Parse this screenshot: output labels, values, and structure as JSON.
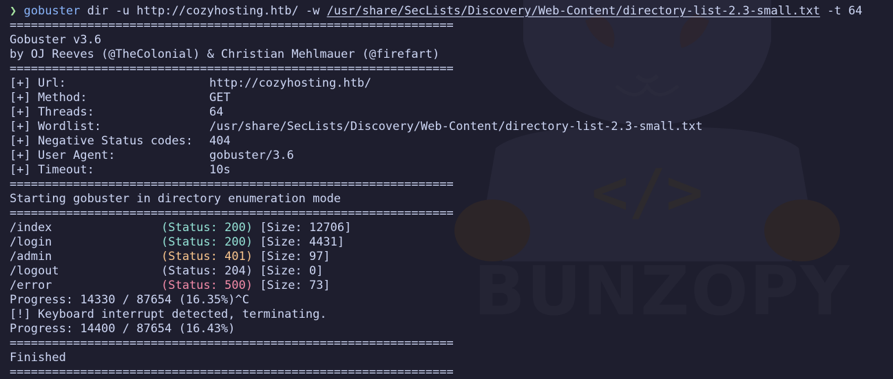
{
  "command": {
    "prompt_symbol": "❯",
    "program": "gobuster",
    "args_before_path": "dir -u http://cozyhosting.htb/ -w",
    "wordlist_path": "/usr/share/SecLists/Discovery/Web-Content/directory-list-2.3-small.txt",
    "args_after_path": "-t 64"
  },
  "separator": "===============================================================",
  "banner": {
    "version": "Gobuster v3.6",
    "authors": "by OJ Reeves (@TheColonial) & Christian Mehlmauer (@firefart)"
  },
  "config": [
    {
      "label": "[+] Url:",
      "value": "http://cozyhosting.htb/"
    },
    {
      "label": "[+] Method:",
      "value": "GET"
    },
    {
      "label": "[+] Threads:",
      "value": "64"
    },
    {
      "label": "[+] Wordlist:",
      "value": "/usr/share/SecLists/Discovery/Web-Content/directory-list-2.3-small.txt"
    },
    {
      "label": "[+] Negative Status codes:",
      "value": "404"
    },
    {
      "label": "[+] User Agent:",
      "value": "gobuster/3.6"
    },
    {
      "label": "[+] Timeout:",
      "value": "10s"
    }
  ],
  "start_message": "Starting gobuster in directory enumeration mode",
  "results": [
    {
      "path": "/index",
      "status": "(Status: 200)",
      "size": "[Size: 12706]"
    },
    {
      "path": "/login",
      "status": "(Status: 200)",
      "size": "[Size: 4431]"
    },
    {
      "path": "/admin",
      "status": "(Status: 401)",
      "size": "[Size: 97]"
    },
    {
      "path": "/logout",
      "status": "(Status: 204)",
      "size": "[Size: 0]"
    },
    {
      "path": "/error",
      "status": "(Status: 500)",
      "size": "[Size: 73]"
    }
  ],
  "progress_1": "Progress: 14330 / 87654 (16.35%)^C",
  "interrupt": "[!] Keyboard interrupt detected, terminating.",
  "progress_2": "Progress: 14400 / 87654 (16.43%)",
  "finished": "Finished",
  "wallpaper": {
    "watermark_text": "BUNZOPY",
    "code_glyph": "</>"
  },
  "colors": {
    "background": "#1e1e2e",
    "foreground": "#cdd6f4",
    "prompt": "#a6e3a1",
    "command": "#89b4fa",
    "status_200": "#94e2d5",
    "status_401": "#f9c58d",
    "status_204": "#cdd6f4",
    "status_500": "#f38ba8"
  }
}
